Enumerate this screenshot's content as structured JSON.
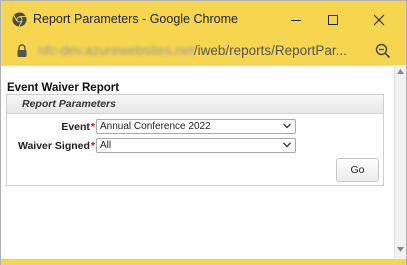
{
  "window": {
    "title": "Report Parameters - Google Chrome",
    "url_host": "nfc-dev.azurewebsites.net",
    "url_path": "/iweb/reports/ReportPar..."
  },
  "report": {
    "title": "Event Waiver Report",
    "panel_title": "Report Parameters",
    "fields": {
      "event_label": "Event",
      "event_value": "Annual Conference 2022",
      "waiver_label": "Waiver Signed",
      "waiver_value": "All",
      "required_marker": "*"
    },
    "go_label": "Go"
  },
  "colors": {
    "titlebar": "#f6d64f",
    "required": "#dd0000"
  },
  "icons": [
    "chrome-icon",
    "minimize-icon",
    "maximize-icon",
    "close-icon",
    "lock-icon",
    "zoom-icon",
    "chevron-down-icon",
    "scroll-up-icon",
    "scroll-down-icon"
  ]
}
